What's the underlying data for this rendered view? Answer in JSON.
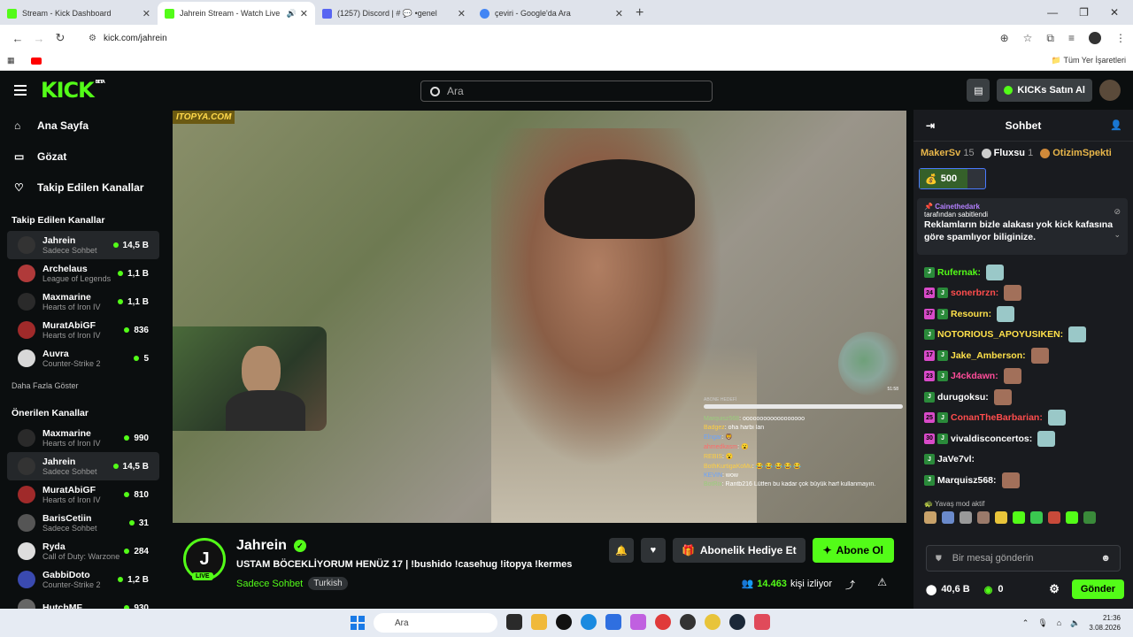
{
  "browser": {
    "tabs": [
      {
        "title": "Stream - Kick Dashboard",
        "color": "#53fc18"
      },
      {
        "title": "Jahrein Stream - Watch Live",
        "color": "#53fc18"
      },
      {
        "title": "(1257) Discord | # 💬 •genel",
        "color": "#5865f2"
      },
      {
        "title": "çeviri - Google'da Ara",
        "color": "#4285f4"
      }
    ],
    "url": "kick.com/jahrein",
    "bookmarks_label": "Tüm Yer İşaretleri"
  },
  "header": {
    "logo": "KICK",
    "beta": "BETA",
    "search_placeholder": "Ara",
    "kicks_button": "KICKs Satın Al"
  },
  "sidebar": {
    "nav": [
      {
        "label": "Ana Sayfa",
        "icon": "⌂"
      },
      {
        "label": "Gözat",
        "icon": "▭"
      },
      {
        "label": "Takip Edilen Kanallar",
        "icon": "♡"
      }
    ],
    "followed_title": "Takip Edilen Kanallar",
    "followed": [
      {
        "name": "Jahrein",
        "category": "Sadece Sohbet",
        "viewers": "14,5 B"
      },
      {
        "name": "Archelaus",
        "category": "League of Legends",
        "viewers": "1,1 B"
      },
      {
        "name": "Maxmarine",
        "category": "Hearts of Iron IV",
        "viewers": "1,1 B"
      },
      {
        "name": "MuratAbiGF",
        "category": "Hearts of Iron IV",
        "viewers": "836"
      },
      {
        "name": "Auvra",
        "category": "Counter-Strike 2",
        "viewers": "5"
      }
    ],
    "show_more": "Daha Fazla Göster",
    "recommended_title": "Önerilen Kanallar",
    "recommended": [
      {
        "name": "Maxmarine",
        "category": "Hearts of Iron IV",
        "viewers": "990"
      },
      {
        "name": "Jahrein",
        "category": "Sadece Sohbet",
        "viewers": "14,5 B"
      },
      {
        "name": "MuratAbiGF",
        "category": "Hearts of Iron IV",
        "viewers": "810"
      },
      {
        "name": "BarisCetiin",
        "category": "Sadece Sohbet",
        "viewers": "31"
      },
      {
        "name": "Ryda",
        "category": "Call of Duty: Warzone",
        "viewers": "284"
      },
      {
        "name": "GabbiDoto",
        "category": "Counter-Strike 2",
        "viewers": "1,2 B"
      },
      {
        "name": "HutchMF",
        "category": "",
        "viewers": "930"
      }
    ]
  },
  "video": {
    "watermark": "ITOPYA.COM",
    "overlay_goal": "ABONE HEDEFİ",
    "overlay_lines": [
      {
        "user": "Marquisz568",
        "text": "oooooooooooooooooo"
      },
      {
        "user": "Badgez",
        "text": "oha harbi lan"
      },
      {
        "user": "Elngar",
        "text": "🦁"
      },
      {
        "user": "ahmedkasm",
        "text": "😮"
      },
      {
        "user": "REBIS",
        "text": "😮"
      },
      {
        "user": "BothKurtigaKoMu",
        "text": "😂 😂 😂 😂 😂"
      },
      {
        "user": "KEVIN",
        "text": "wow"
      },
      {
        "user": "BotRix",
        "text": "Rantb216 Lütfen bu kadar çok büyük harf kullanmayın."
      }
    ],
    "mascot_time": "51:58"
  },
  "stream": {
    "avatar_letter": "J",
    "live": "LIVE",
    "name": "Jahrein",
    "title": "USTAM BÖCEKLİYORUM HENÜZ 17 | !bushido !casehug !itopya !kermes",
    "category": "Sadece Sohbet",
    "language": "Turkish",
    "gift_button": "Abonelik Hediye Et",
    "subscribe_button": "Abone Ol",
    "viewers": "14.463",
    "viewers_label": "kişi izliyor"
  },
  "chat": {
    "title": "Sohbet",
    "leaders": [
      {
        "name": "MakerSv",
        "count": "15"
      },
      {
        "name": "Fluxsu",
        "count": "1"
      },
      {
        "name": "OtizimSpekti",
        "count": ""
      }
    ],
    "kicks_amount": "500",
    "pinned_by": "Cainethedark",
    "pinned_by_suffix": "tarafından sabitlendi",
    "pinned_message": "Reklamların bizle alakası yok kick kafasına göre spamlıyor biliginize.",
    "messages": [
      {
        "user": "Rufernak:",
        "color": "#53fc18",
        "badge": ""
      },
      {
        "user": "sonerbrzn:",
        "color": "#ff4d4d",
        "badge": "24"
      },
      {
        "user": "Resourn:",
        "color": "#ffe14a",
        "badge": "37"
      },
      {
        "user": "NOTORIOUS_APOYUSIKEN:",
        "color": "#ffe14a",
        "badge": ""
      },
      {
        "user": "Jake_Amberson:",
        "color": "#ffe14a",
        "badge": "17"
      },
      {
        "user": "J4ckdawn:",
        "color": "#ff4d9a",
        "badge": "23"
      },
      {
        "user": "durugoksu:",
        "color": "#ffffff",
        "badge": ""
      },
      {
        "user": "ConanTheBarbarian:",
        "color": "#ff4d4d",
        "badge": "25"
      },
      {
        "user": "vivaldisconcertos:",
        "color": "#ffffff",
        "badge": "30"
      },
      {
        "user": "JaVe7vl:",
        "color": "#ffffff",
        "badge": ""
      },
      {
        "user": "Marquisz568:",
        "color": "#ffffff",
        "badge": ""
      }
    ],
    "slow_mode": "Yavaş mod aktif",
    "input_placeholder": "Bir mesaj gönderin",
    "points": "40,6 B",
    "kicks": "0",
    "send_button": "Gönder"
  },
  "taskbar": {
    "search": "Ara",
    "time": "21:36",
    "date": "3.08.2026"
  }
}
